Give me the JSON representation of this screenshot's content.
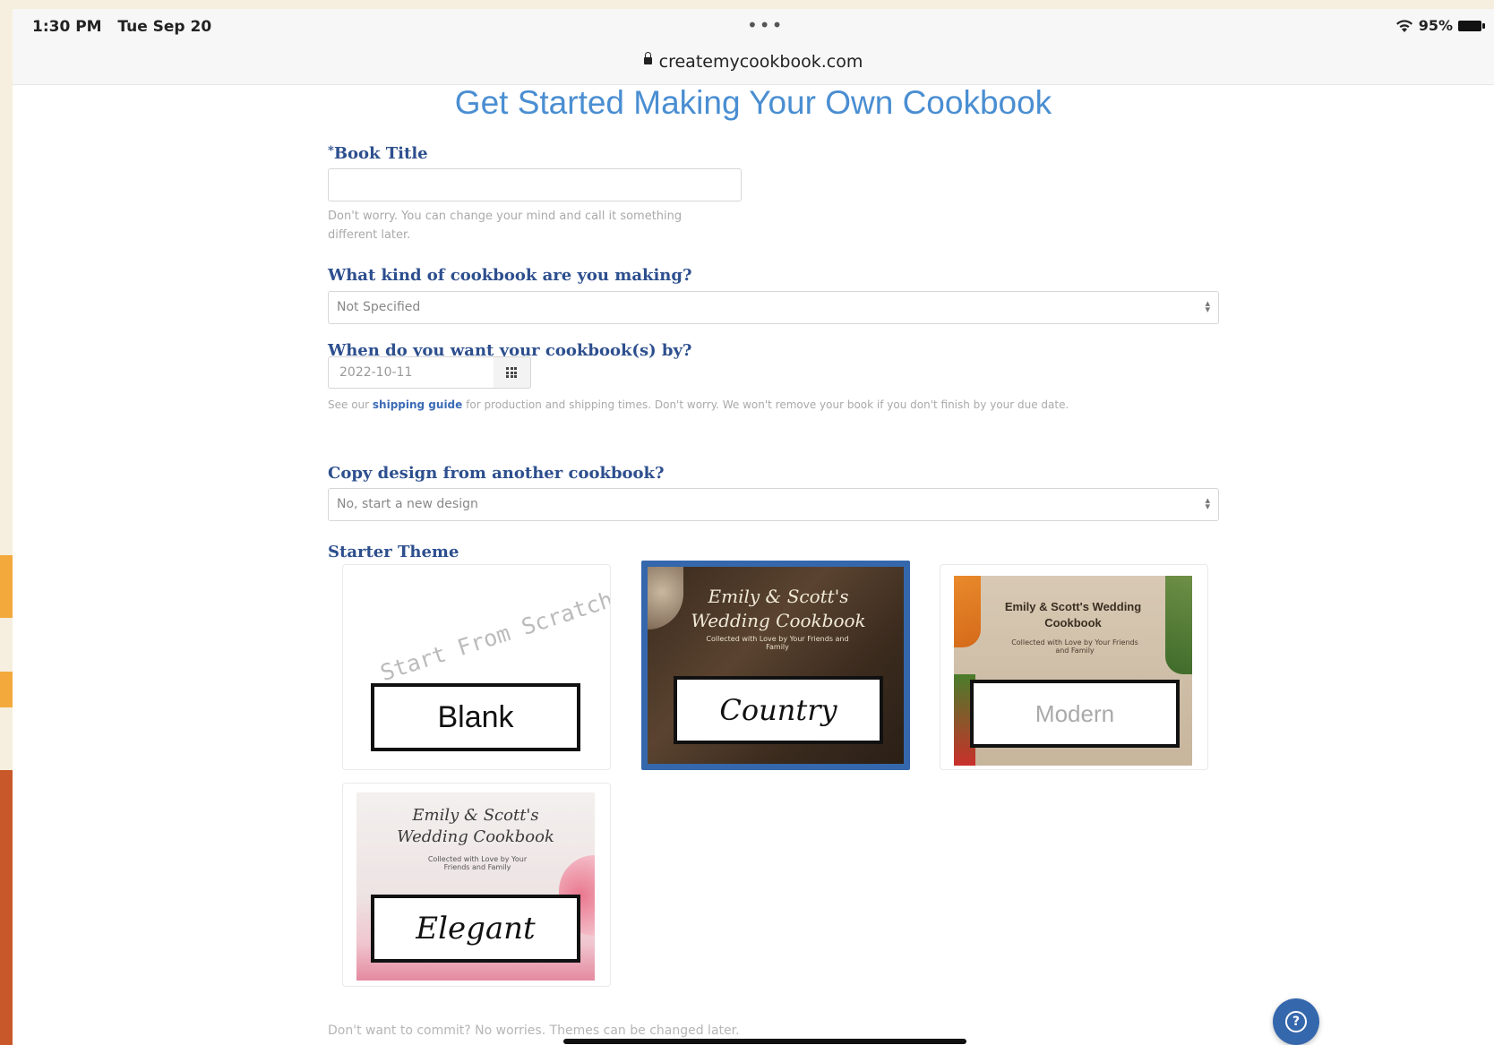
{
  "status_bar": {
    "time": "1:30 PM",
    "date": "Tue Sep 20",
    "dots": "•••",
    "battery": "95%"
  },
  "browser": {
    "url": "createmycookbook.com"
  },
  "page": {
    "title": "Get Started Making Your Own Cookbook"
  },
  "form": {
    "book_title": {
      "required_mark": "*",
      "label": "Book Title",
      "value": "",
      "help_line1": "Don't worry. You can change your mind and call it something",
      "help_line2": "different later."
    },
    "cookbook_kind": {
      "label": "What kind of cookbook are you making?",
      "selected": "Not Specified"
    },
    "due_date": {
      "label": "When do you want your cookbook(s) by?",
      "value": "2022-10-11",
      "help_prefix": "See our",
      "help_link": "shipping guide",
      "help_suffix": "for production and shipping times. Don't worry. We won't remove your book if you don't finish by your due date."
    },
    "copy_design": {
      "label": "Copy design from another cookbook?",
      "selected": "No, start a new design"
    },
    "starter_theme": {
      "label": "Starter Theme",
      "themes": [
        {
          "name": "Blank",
          "hint": "Start From Scratch",
          "selected": false
        },
        {
          "name": "Country",
          "cover_title": "Emily & Scott's Wedding Cookbook",
          "cover_sub": "Collected with Love by Your Friends and Family",
          "selected": true
        },
        {
          "name": "Modern",
          "cover_title": "Emily & Scott's Wedding Cookbook",
          "cover_sub": "Collected with Love by Your Friends and Family",
          "selected": false
        },
        {
          "name": "Elegant",
          "cover_title": "Emily & Scott's Wedding Cookbook",
          "cover_sub": "Collected with Love by Your Friends and Family",
          "selected": false
        }
      ]
    },
    "footer_note": "Don't want to commit? No worries. Themes can be changed later."
  },
  "help_button": {
    "icon": "question-circle-icon"
  },
  "colors": {
    "accent": "#3567ad",
    "title": "#4a8ed2",
    "label": "#2d4f8e"
  }
}
